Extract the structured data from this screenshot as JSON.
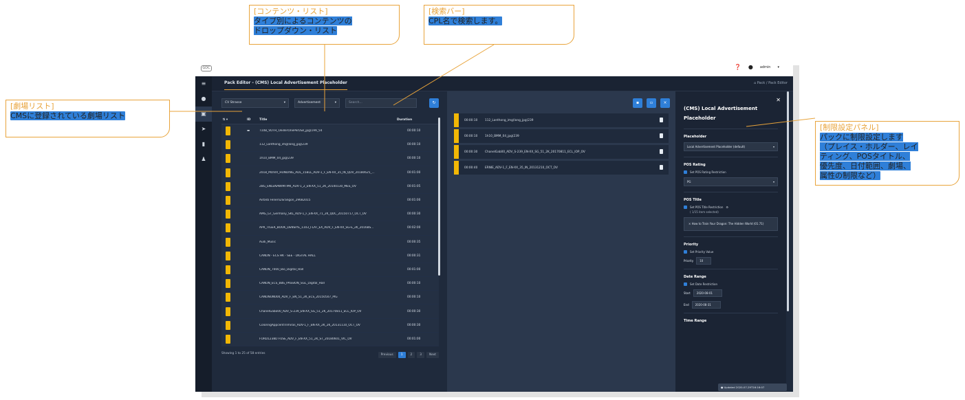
{
  "callouts": {
    "content_list": {
      "title": "[コンテンツ・リスト]",
      "body": "タイプ別によるコンテンツの\nドロップダウン・リスト"
    },
    "search_bar": {
      "title": "[検索バー]",
      "body": "CPL名で検索します。"
    },
    "theater_list": {
      "title": "[劇場リスト]",
      "body": "CMSに登録されている劇場リスト"
    },
    "restriction_panel": {
      "title": "[制限設定パネル]",
      "body": "パックに制限設定します\n（プレイス・ホルダー、レイ\nティング、POSタイトル、\n優先度、日付範囲、劇場、\n属性の制限など）"
    }
  },
  "app": {
    "logo": "GDC",
    "user": "admin",
    "page_title": "Pack Editor - (CMS) Local Advertisement Placeholder",
    "breadcrumb": "Pack / Pack Editor",
    "filters": {
      "theater": "CV Strasse",
      "type": "Advertisement",
      "search_placeholder": "Search..."
    },
    "table": {
      "columns": [
        "ID",
        "Title",
        "Duration"
      ],
      "rows": [
        {
          "title": "T10B_VDTH_OeillerOnePerDwl_jpg(199_54",
          "duration": "00:00:10"
        },
        {
          "title": "112_Lanthong_img(long_jpg(239",
          "duration": "00:00:10"
        },
        {
          "title": "1h10_BMM_04_jpg(239",
          "duration": "00:00:10"
        },
        {
          "title": "2018_MOVIX_HUNDING_ADL_15BLL_ADV-1_F_EN-XX_35_IN_QDV_20180625_...",
          "duration": "00:01:00"
        },
        {
          "title": "2BG_ENLENAWIMTMK_ADV-1_2_EN-XX_51_2K_20140130_MES_OV",
          "duration": "00:01:05"
        },
        {
          "title": "Airbnb Fenerli2Srangon_29682015",
          "duration": "00:01:00"
        },
        {
          "title": "AMG_GT_Germany_SKL_ADV-1_F_EN-XX_71_2K_QDC_20150717_OCT_OV",
          "duration": "00:00:30"
        },
        {
          "title": "APR_TIGER_BOOK_DENSIYE_1103_FLAT_EX_ADV_F_EN-XX_SG-E_2K_2016BS...",
          "duration": "00:02:00"
        },
        {
          "title": "Audi_Music",
          "duration": "00:00:35"
        },
        {
          "title": "CANON - ECS HK - SEE - DIGITAL HALL",
          "duration": "00:00:31"
        },
        {
          "title": "CANON_7000_Bio_Digital_Hall",
          "duration": "00:01:00"
        },
        {
          "title": "CANON_ECS_BBS_PASSION_SGL_Digital_Hall",
          "duration": "00:00:10"
        },
        {
          "title": "CANONUN000_ADV_F_EN_51_2K_ECS_20150507_PIG",
          "duration": "00:00:10"
        },
        {
          "title": "ChanelGabo00_ADV_S-239_EN-XX_SG_51_2K_20170811_ECL_IOP_OV",
          "duration": "00:00:30"
        },
        {
          "title": "ColoringAppcentTrimiras_ADV-1_F_EN-XX_2K_2K_20131110_OCT_OV",
          "duration": "00:00:30"
        },
        {
          "title": "FORD1238D FUSE_ADV_F_EN-XX_51_2K_ST_20180601_VIC_OV",
          "duration": "00:01:00"
        }
      ]
    },
    "pager": {
      "info": "Showing 1 to 25 of 58 entries",
      "prev": "Previous",
      "pages": [
        "1",
        "2",
        "3"
      ],
      "next": "Next"
    },
    "playlist": [
      {
        "time": "00:00:10",
        "title": "112_Lanthong_img(long_jpg(239"
      },
      {
        "time": "00:00:10",
        "title": "1h10_BMM_04_jpg(239"
      },
      {
        "time": "00:00:30",
        "title": "ChanelGab00_ADV_S-239_EN-XX_SG_51_2K_20170811_ECL_IOP_OV"
      },
      {
        "time": "00:00:40",
        "title": "ERNIE_ADV-1_F_EN-XX_35_IN_20131210_OCT_OV"
      }
    ],
    "panel": {
      "title": "(CMS) Local Advertisement Placeholder",
      "placeholder_label": "Placeholder",
      "placeholder_value": "Local Advertisement Placeholder (default)",
      "pos_rating_label": "POS Rating",
      "pos_rating_check": "Set POS Rating Restriction",
      "pos_rating_value": "PG",
      "pos_title_label": "POS Title",
      "pos_title_check": "Set POS Title Restriction",
      "pos_title_count": "( 1/15 item selected)",
      "pos_title_item": "× How to Train Your Dragon: The Hidden World (01.71)",
      "priority_label": "Priority",
      "priority_check": "Set Priority Value",
      "priority_key": "Priority",
      "priority_value": "10",
      "date_label": "Date Range",
      "date_check": "Set Date Restriction",
      "start_key": "Start",
      "start_value": "2020-08-01",
      "end_key": "End",
      "end_value": "2020-08-31",
      "time_label": "Time Range"
    },
    "toast": "Updated 2020-07-29T16:16:07"
  }
}
